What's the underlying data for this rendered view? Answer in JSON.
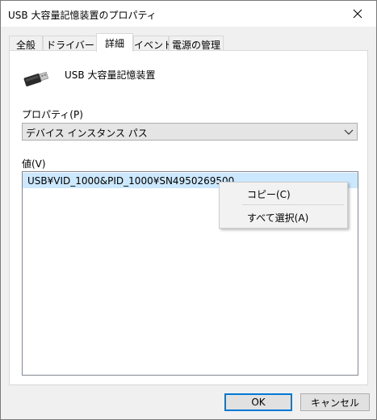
{
  "window": {
    "title": "USB 大容量記憶装置のプロパティ",
    "close_glyph": "✕"
  },
  "tabs": [
    {
      "label": "全般",
      "active": false
    },
    {
      "label": "ドライバー",
      "active": false
    },
    {
      "label": "詳細",
      "active": true
    },
    {
      "label": "イベント",
      "active": false
    },
    {
      "label": "電源の管理",
      "active": false
    }
  ],
  "details": {
    "device_icon": "usb-drive-icon",
    "device_name": "USB 大容量記憶装置",
    "property_label": "プロパティ(P)",
    "property_selected": "デバイス インスタンス パス",
    "value_label": "値(V)",
    "values": [
      "USB¥VID_1000&PID_1000¥SN4950269500"
    ]
  },
  "context_menu": {
    "items": [
      "コピー(C)",
      "すべて選択(A)"
    ]
  },
  "buttons": {
    "ok": "OK",
    "cancel": "キャンセル"
  },
  "colors": {
    "accent": "#0078d7",
    "selection": "#cce8ff"
  }
}
